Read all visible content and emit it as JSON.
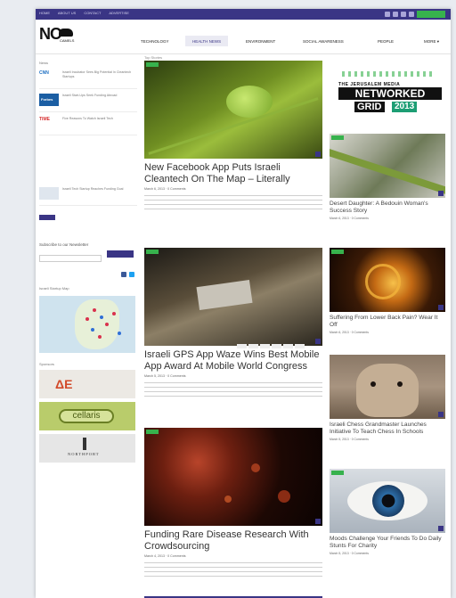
{
  "topbar": {
    "links": [
      "HOME",
      "ABOUT US",
      "CONTACT",
      "ADVERTISE"
    ]
  },
  "logo": {
    "text": "NO",
    "sub": "CAMELS"
  },
  "nav": [
    {
      "label": "TECHNOLOGY",
      "active": false
    },
    {
      "label": "HEALTH NEWS",
      "active": true
    },
    {
      "label": "ENVIRONMENT",
      "active": false
    },
    {
      "label": "SOCIAL AWARENESS",
      "active": false
    },
    {
      "label": "PEOPLE",
      "active": false
    },
    {
      "label": "MORE ▾",
      "active": false
    }
  ],
  "sidebar": {
    "heading": "News",
    "partners": [
      {
        "logo": "CNN",
        "text": "Israeli Incubator Sees Big Potential In Cleantech Startups"
      },
      {
        "logo": "Forbes",
        "text": "Israeli Start-Ups Seek Funding Abroad"
      },
      {
        "logo": "TIME",
        "text": "Five Reasons To Watch Israeli Tech"
      },
      {
        "logo": "",
        "text": "Israeli Tech Startup Reaches Funding Goal"
      }
    ],
    "newsletter_title": "Subscribe to our Newsletter",
    "map_label": "Israeli Startup Map",
    "sponsors_label": "Sponsors",
    "sponsors": [
      "ΔE",
      "cellaris",
      "NORTHPORT"
    ]
  },
  "main": {
    "section_label": "Top Stories",
    "articles": [
      {
        "title": "New Facebook App Puts Israeli Cleantech On The Map – Literally",
        "meta": "March 6, 2013 · 0 Comments"
      },
      {
        "title": "Israeli GPS App Waze Wins Best Mobile App Award At Mobile World Congress",
        "meta": "March 5, 2013 · 0 Comments"
      },
      {
        "title": "Funding Rare Disease Research With Crowdsourcing",
        "meta": "March 4, 2013 · 0 Comments"
      }
    ]
  },
  "right": {
    "promo": {
      "line1": "THE JERUSALEM MEDIA",
      "line2": "NETWORKED",
      "line3": "GRID",
      "year": "2013"
    },
    "articles": [
      {
        "title": "Desert Daughter: A Bedouin Woman's Success Story",
        "meta": "March 6, 2013 · 0 Comments"
      },
      {
        "title": "Suffering From Lower Back Pain? Wear It Off",
        "meta": "March 6, 2013 · 0 Comments"
      },
      {
        "title": "Israeli Chess Grandmaster Launches Initiative To Teach Chess In Schools",
        "meta": "March 5, 2013 · 0 Comments"
      },
      {
        "title": "Moods Challenge Your Friends To Do Daily Stunts For Charity",
        "meta": "March 5, 2013 · 0 Comments"
      }
    ]
  }
}
